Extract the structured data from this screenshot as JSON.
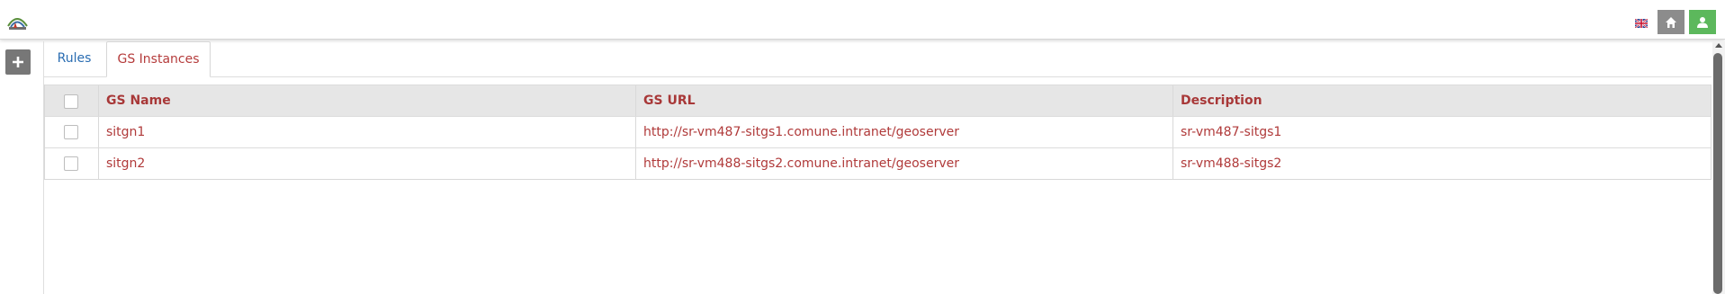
{
  "header": {
    "logo_alt": "GeoStore",
    "language_flag": "uk-flag-icon",
    "home_icon": "home-icon",
    "user_icon": "user-icon",
    "colors": {
      "home_button": "#8c8c8c",
      "user_button": "#5cb85c"
    }
  },
  "sidebar": {
    "add_icon": "plus-icon"
  },
  "tabs": [
    {
      "label": "Rules",
      "active": false
    },
    {
      "label": "GS Instances",
      "active": true
    }
  ],
  "table": {
    "columns": [
      "GS Name",
      "GS URL",
      "Description"
    ],
    "rows": [
      {
        "name": "sitgn1",
        "url": "http://sr-vm487-sitgs1.comune.intranet/geoserver",
        "description": "sr-vm487-sitgs1"
      },
      {
        "name": "sitgn2",
        "url": "http://sr-vm488-sitgs2.comune.intranet/geoserver",
        "description": "sr-vm488-sitgs2"
      }
    ]
  },
  "colors": {
    "accent_text": "#b03a3a",
    "link_blue": "#2a6db2"
  }
}
